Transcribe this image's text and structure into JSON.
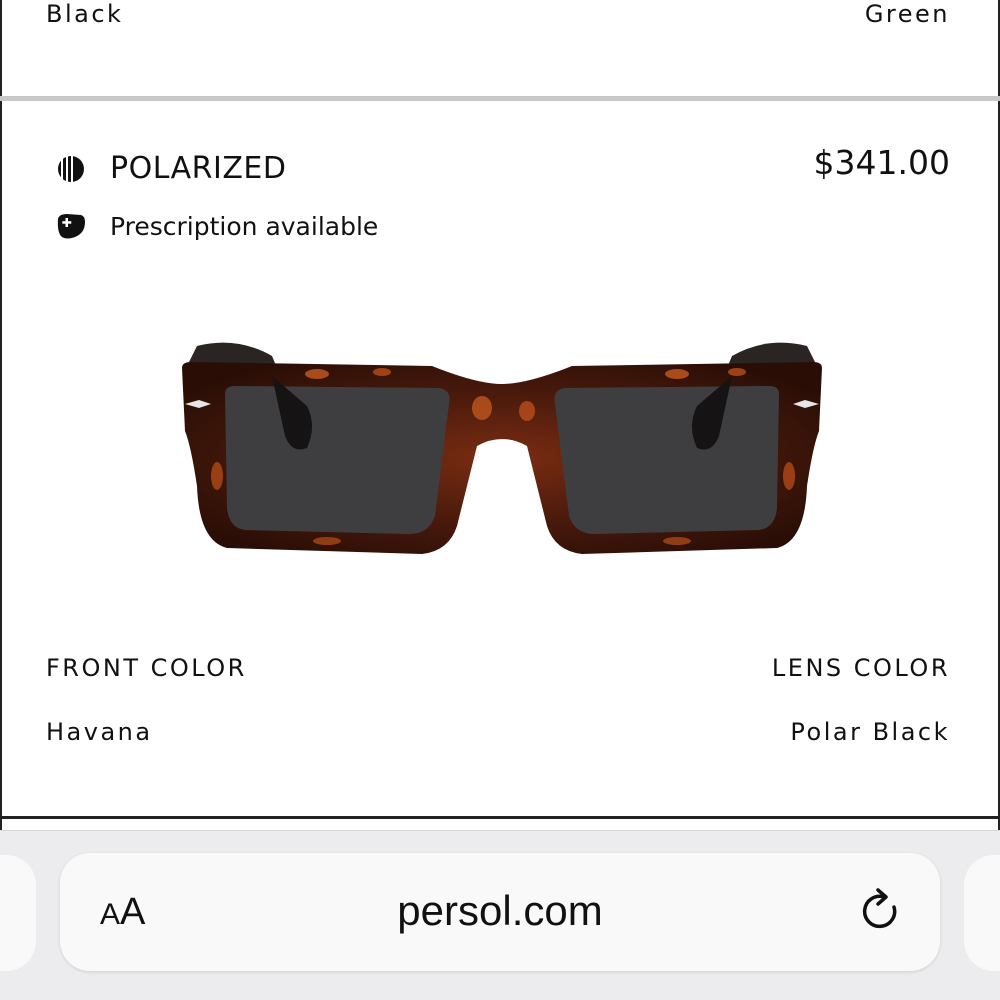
{
  "previous_item": {
    "front_color": "Black",
    "lens_color": "Green"
  },
  "product": {
    "features": [
      {
        "icon": "polarized-icon",
        "label": "POLARIZED"
      },
      {
        "icon": "prescription-icon",
        "label": "Prescription available"
      }
    ],
    "price": "$341.00",
    "image": "tortoise-sunglasses",
    "front_color_label": "FRONT COLOR",
    "front_color_value": "Havana",
    "lens_color_label": "LENS COLOR",
    "lens_color_value": "Polar Black"
  },
  "browser": {
    "text_size_label_small": "A",
    "text_size_label_large": "A",
    "url": "persol.com",
    "reload_icon": "reload-icon"
  }
}
